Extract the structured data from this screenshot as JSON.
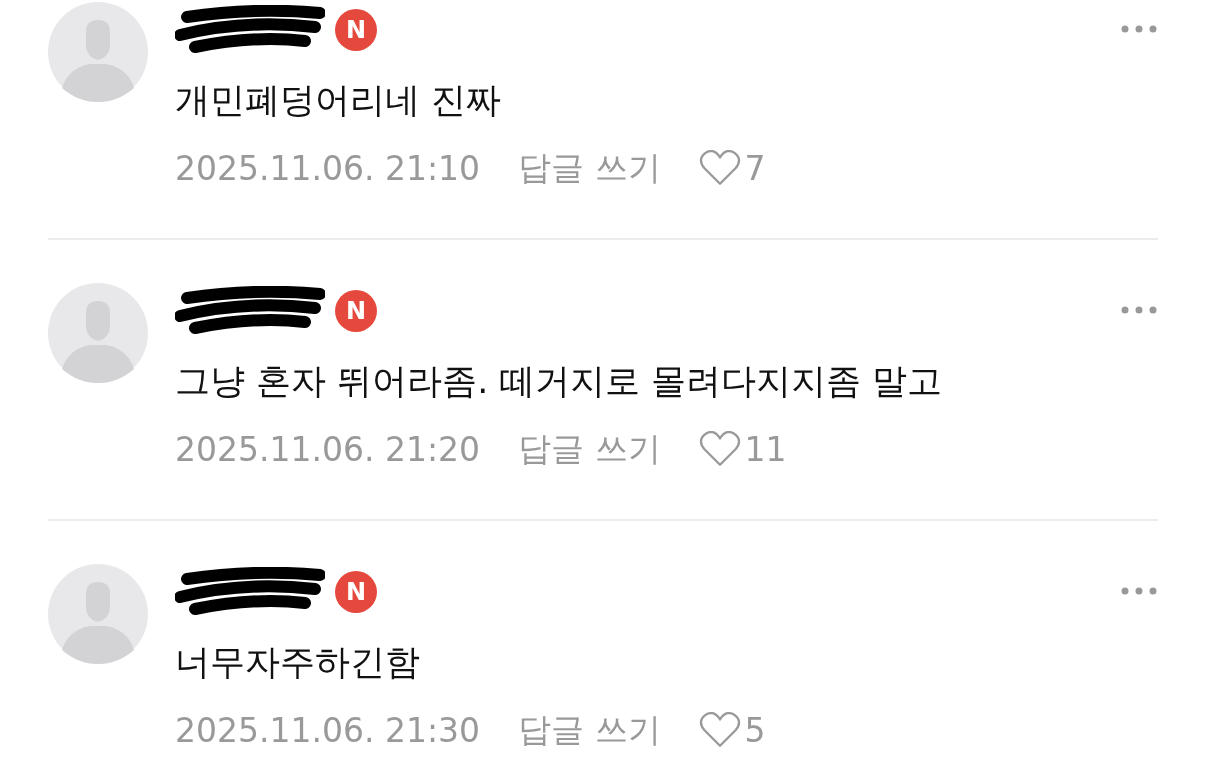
{
  "comments": [
    {
      "badge": "N",
      "text": "개민폐덩어리네 진짜",
      "time": "2025.11.06. 21:10",
      "reply_label": "답글 쓰기",
      "likes": "7"
    },
    {
      "badge": "N",
      "text": "그냥 혼자 뛰어라좀. 떼거지로 몰려다지지좀 말고",
      "time": "2025.11.06. 21:20",
      "reply_label": "답글 쓰기",
      "likes": "11"
    },
    {
      "badge": "N",
      "text": "너무자주하긴함",
      "time": "2025.11.06. 21:30",
      "reply_label": "답글 쓰기",
      "likes": "5"
    }
  ]
}
